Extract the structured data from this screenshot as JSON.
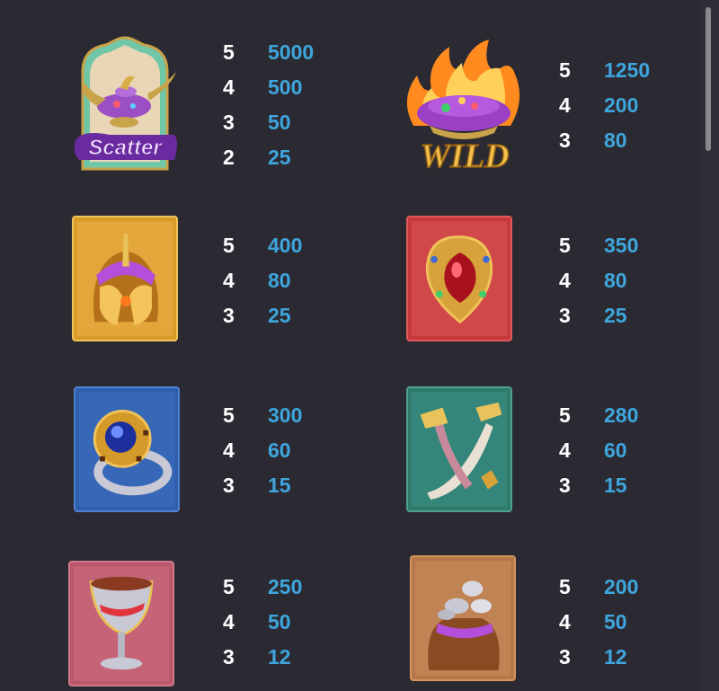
{
  "symbols": [
    {
      "name": "scatter-lamp",
      "label": "Scatter",
      "pays": [
        {
          "count": "5",
          "amount": "5000"
        },
        {
          "count": "4",
          "amount": "500"
        },
        {
          "count": "3",
          "amount": "50"
        },
        {
          "count": "2",
          "amount": "25"
        }
      ]
    },
    {
      "name": "wild-genie",
      "label": "WILD",
      "pays": [
        {
          "count": "5",
          "amount": "1250"
        },
        {
          "count": "4",
          "amount": "200"
        },
        {
          "count": "3",
          "amount": "80"
        }
      ]
    },
    {
      "name": "helmet",
      "pays": [
        {
          "count": "5",
          "amount": "400"
        },
        {
          "count": "4",
          "amount": "80"
        },
        {
          "count": "3",
          "amount": "25"
        }
      ]
    },
    {
      "name": "ruby-amulet",
      "pays": [
        {
          "count": "5",
          "amount": "350"
        },
        {
          "count": "4",
          "amount": "80"
        },
        {
          "count": "3",
          "amount": "25"
        }
      ]
    },
    {
      "name": "sapphire-ring",
      "pays": [
        {
          "count": "5",
          "amount": "300"
        },
        {
          "count": "4",
          "amount": "60"
        },
        {
          "count": "3",
          "amount": "15"
        }
      ]
    },
    {
      "name": "crossed-daggers",
      "pays": [
        {
          "count": "5",
          "amount": "280"
        },
        {
          "count": "4",
          "amount": "60"
        },
        {
          "count": "3",
          "amount": "15"
        }
      ]
    },
    {
      "name": "goblet",
      "pays": [
        {
          "count": "5",
          "amount": "250"
        },
        {
          "count": "4",
          "amount": "50"
        },
        {
          "count": "3",
          "amount": "12"
        }
      ]
    },
    {
      "name": "coin-pouch",
      "pays": [
        {
          "count": "5",
          "amount": "200"
        },
        {
          "count": "4",
          "amount": "50"
        },
        {
          "count": "3",
          "amount": "12"
        }
      ]
    }
  ],
  "colors": {
    "background": "#2b2a33",
    "count_text": "#ffffff",
    "amount_text": "#3ea6dc"
  }
}
